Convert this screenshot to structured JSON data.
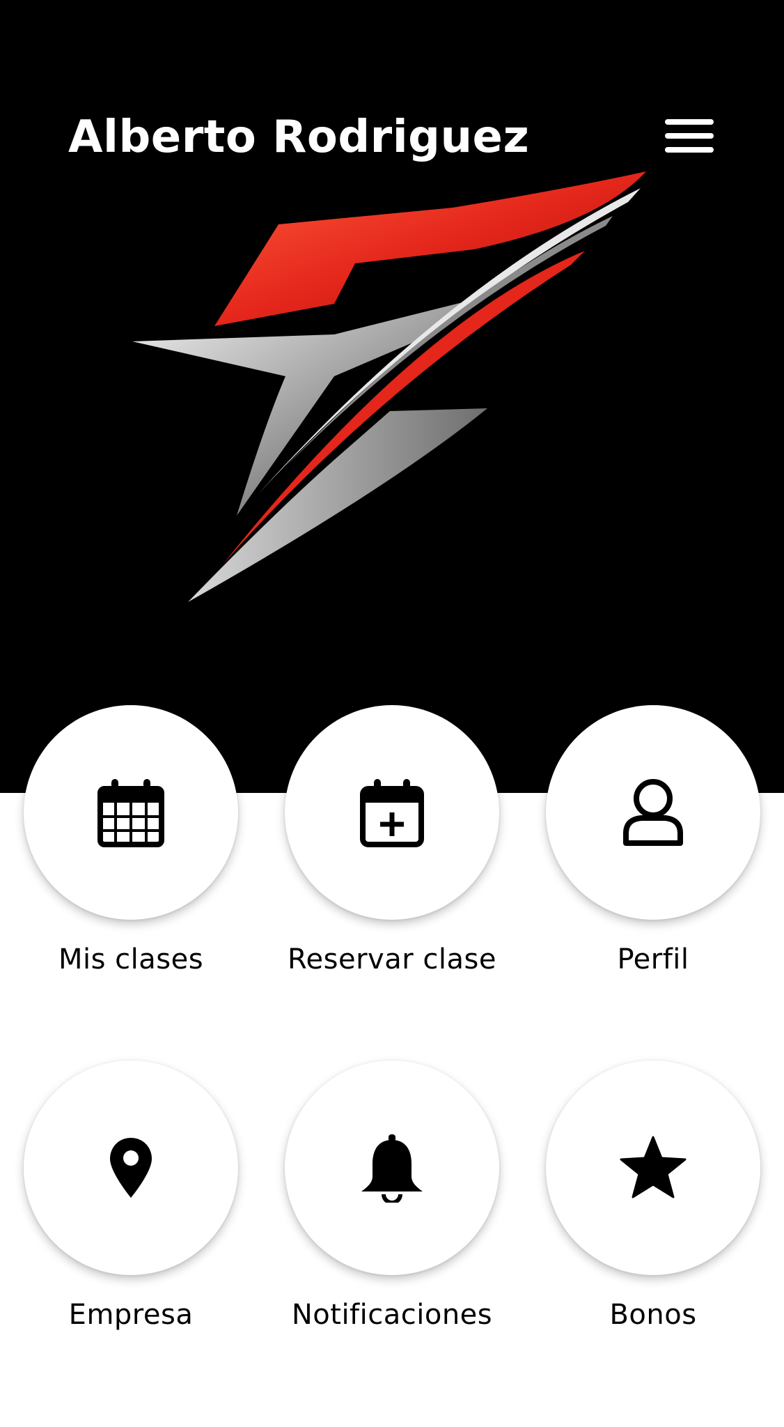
{
  "header": {
    "user_name": "Alberto Rodriguez",
    "menu_icon": "hamburger-menu-icon"
  },
  "colors": {
    "hero_background": "#000000",
    "accent_red": "#e4261b",
    "metal_gray": "#b8b8b8",
    "tile_background": "#ffffff",
    "text": "#000000"
  },
  "tiles": [
    {
      "label": "Mis clases",
      "icon": "calendar-grid-icon"
    },
    {
      "label": "Reservar clase",
      "icon": "calendar-plus-icon"
    },
    {
      "label": "Perfil",
      "icon": "user-icon"
    },
    {
      "label": "Empresa",
      "icon": "map-pin-icon"
    },
    {
      "label": "Notificaciones",
      "icon": "bell-icon"
    },
    {
      "label": "Bonos",
      "icon": "star-icon"
    }
  ]
}
